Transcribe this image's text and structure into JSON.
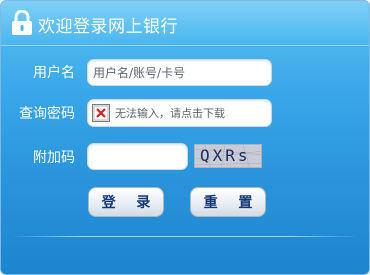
{
  "header": {
    "title": "欢迎登录网上银行",
    "icon": "lock-icon"
  },
  "form": {
    "username": {
      "label": "用户名",
      "placeholder": "用户名/账号/卡号",
      "value": ""
    },
    "password": {
      "label": "查询密码",
      "plugin_message": "无法输入，请点击下载",
      "icon": "broken-plugin-icon"
    },
    "captcha": {
      "label": "附加码",
      "value": "",
      "image_text": "QXRs"
    }
  },
  "buttons": {
    "login_label": "登 录",
    "reset_label": "重 置"
  },
  "colors": {
    "panel_top": "#5fc1f3",
    "panel_bottom": "#1d84cf",
    "button_text": "#163a78"
  }
}
